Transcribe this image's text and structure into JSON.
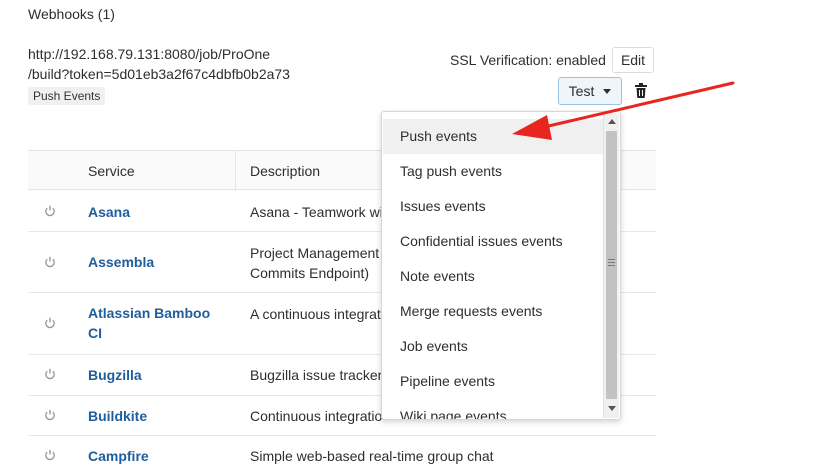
{
  "webhooks": {
    "title": "Webhooks (1)",
    "url_line1": "http://192.168.79.131:8080/job/ProOne",
    "url_line2": "/build?token=5d01eb3a2f67c4dbfb0b2a73",
    "trigger_badge": "Push Events",
    "ssl_status": "SSL Verification: enabled",
    "edit_label": "Edit",
    "test_label": "Test"
  },
  "table": {
    "headers": [
      "Service",
      "Description"
    ],
    "rows": [
      {
        "service": "Asana",
        "description": "Asana - Teamwork wi"
      },
      {
        "service": "Assembla",
        "description_line1": "Project Management",
        "description_line2": "Commits Endpoint)"
      },
      {
        "service_line1": "Atlassian Bamboo",
        "service_line2": "CI",
        "description": "A continuous integrat"
      },
      {
        "service": "Bugzilla",
        "description": "Bugzilla issue tracker"
      },
      {
        "service": "Buildkite",
        "description": "Continuous integratio"
      },
      {
        "service": "Campfire",
        "description": "Simple web-based real-time group chat"
      }
    ]
  },
  "test_dropdown": {
    "items": [
      "Push events",
      "Tag push events",
      "Issues events",
      "Confidential issues events",
      "Note events",
      "Merge requests events",
      "Job events",
      "Pipeline events",
      "Wiki page events"
    ],
    "highlighted": "Push events"
  },
  "colors": {
    "link": "#1f5e9c",
    "annotation_arrow": "#e8251f",
    "test_button_border": "#9bc2e6"
  }
}
